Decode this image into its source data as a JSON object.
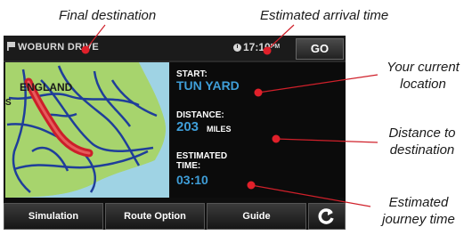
{
  "callouts": {
    "final_destination": "Final destination",
    "estimated_arrival": "Estimated arrival time",
    "current_location_1": "Your current",
    "current_location_2": "location",
    "distance_1": "Distance to",
    "distance_2": "destination",
    "journey_1": "Estimated",
    "journey_2": "journey time"
  },
  "device": {
    "destination": "WOBURN DRIVE",
    "arrival_time": "17:10",
    "arrival_suffix": "PM",
    "go_label": "GO",
    "map_label": "ENGLAND",
    "map_edge_label": "S",
    "start_label": "START:",
    "start_value": "TUN YARD",
    "distance_label": "DISTANCE:",
    "distance_value": "203",
    "distance_unit": "MILES",
    "time_label_1": "ESTIMATED",
    "time_label_2": "TIME:",
    "time_value": "03:10",
    "buttons": {
      "simulation": "Simulation",
      "route_option": "Route Option",
      "guide": "Guide"
    }
  },
  "colors": {
    "accent_blue": "#3f9ed8",
    "callout_line": "#d0202a",
    "route": "#cc1f2a",
    "sea": "#9fd3e4",
    "land": "#a7d46d"
  },
  "icons": [
    "flag-icon",
    "clock-icon",
    "back-arrow-icon"
  ]
}
